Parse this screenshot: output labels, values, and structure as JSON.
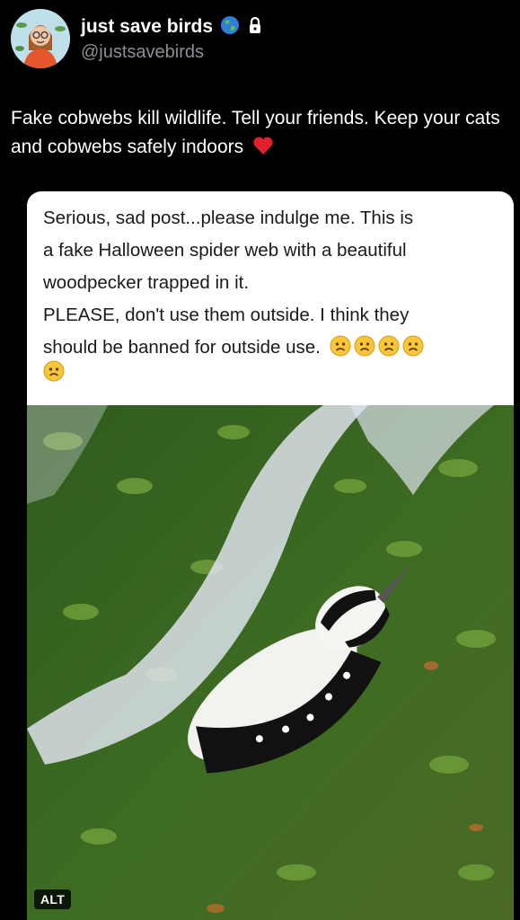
{
  "profile": {
    "display_name": "just save birds",
    "handle": "@justsavebirds",
    "badges": [
      "globe-icon",
      "lock-icon"
    ]
  },
  "tweet": {
    "text": "Fake cobwebs kill wildlife. Tell your friends. Keep your cats and cobwebs safely indoors",
    "trailing_emoji": "red-heart-icon"
  },
  "quoted_card": {
    "lines": [
      "Serious, sad post...please indulge me. This is",
      "a fake Halloween spider web with a beautiful",
      "woodpecker trapped in it.",
      "PLEASE, don't use them outside. I think they",
      "should be banned for outside use."
    ],
    "emoji_count": 5,
    "emoji": "frowning-face-icon"
  },
  "media": {
    "alt_label": "ALT"
  },
  "colors": {
    "background": "#000000",
    "handle": "#8b8f94",
    "card_bg": "#ffffff",
    "heart": "#e0202b"
  }
}
